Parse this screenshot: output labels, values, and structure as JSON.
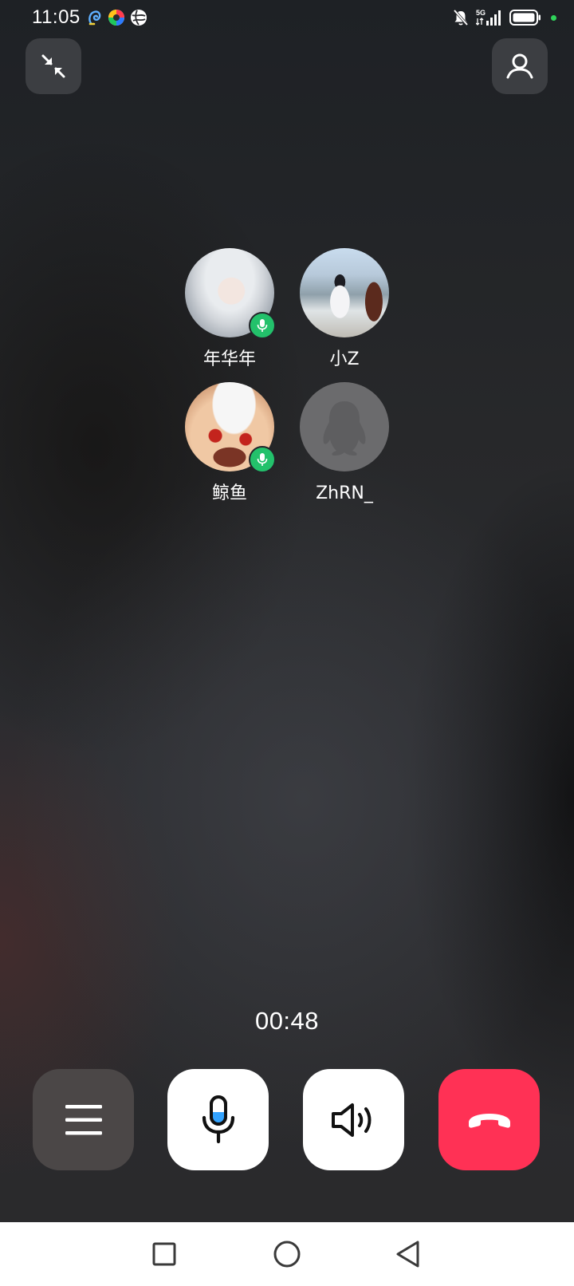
{
  "status_bar": {
    "time": "11:05",
    "left_icons": [
      "assistant-app-icon",
      "colorful-app-icon",
      "globe-app-icon"
    ],
    "right_icons": [
      "bell-muted-icon",
      "signal-5g-icon",
      "battery-icon",
      "privacy-indicator-dot"
    ],
    "network_label": "5G",
    "indicator_color": "#2fd35a"
  },
  "top_bar": {
    "minimize_icon": "minimize-arrows-icon",
    "contacts_icon": "person-icon"
  },
  "participants": [
    {
      "name": "年华年",
      "speaking": true
    },
    {
      "name": "小Z",
      "speaking": false
    },
    {
      "name": "鲸鱼",
      "speaking": true
    },
    {
      "name": "ZhRN_",
      "speaking": false
    }
  ],
  "call": {
    "duration": "00:48"
  },
  "controls": {
    "menu_icon": "hamburger-menu-icon",
    "mic_icon": "microphone-icon",
    "speaker_icon": "speaker-icon",
    "hangup_icon": "hang-up-phone-icon",
    "hangup_color": "#ff3155",
    "speaking_badge_color": "#23c16b"
  },
  "nav_bar": {
    "recent_icon": "square-recents-icon",
    "home_icon": "circle-home-icon",
    "back_icon": "triangle-back-icon"
  }
}
